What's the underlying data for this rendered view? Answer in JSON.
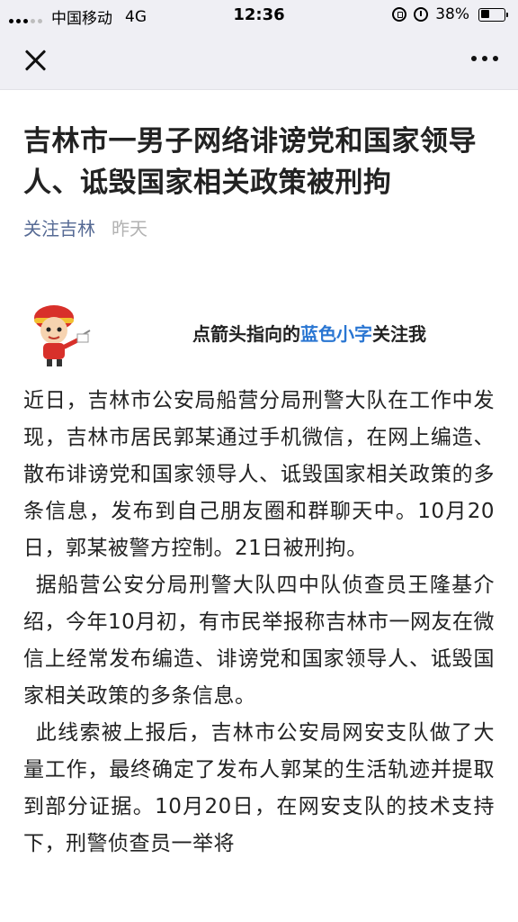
{
  "status_bar": {
    "carrier": "中国移动",
    "network": "4G",
    "time": "12:36",
    "battery": "38%",
    "battery_level": 0.38
  },
  "article": {
    "title": "吉林市一男子网络诽谤党和国家领导人、诋毁国家相关政策被刑拘",
    "account": "关注吉林",
    "published": "昨天",
    "banner": {
      "prefix": "点箭头指向的",
      "highlight": "蓝色小字",
      "suffix": "关注我"
    },
    "paragraphs": [
      "近日，吉林市公安局船营分局刑警大队在工作中发现，吉林市居民郭某通过手机微信，在网上编造、散布诽谤党和国家领导人、诋毁国家相关政策的多条信息，发布到自己朋友圈和群聊天中。10月20日，郭某被警方控制。21日被刑拘。",
      "据船营公安分局刑警大队四中队侦查员王隆基介绍，今年10月初，有市民举报称吉林市一网友在微信上经常发布编造、诽谤党和国家领导人、诋毁国家相关政策的多条信息。",
      "此线索被上报后，吉林市公安局网安支队做了大量工作，最终确定了发布人郭某的生活轨迹并提取到部分证据。10月20日，在网安支队的技术支持下，刑警侦查员一举将"
    ]
  },
  "colors": {
    "link_blue": "#576b95",
    "highlight_blue": "#2a76d2",
    "bar_gray": "#efeff4"
  }
}
